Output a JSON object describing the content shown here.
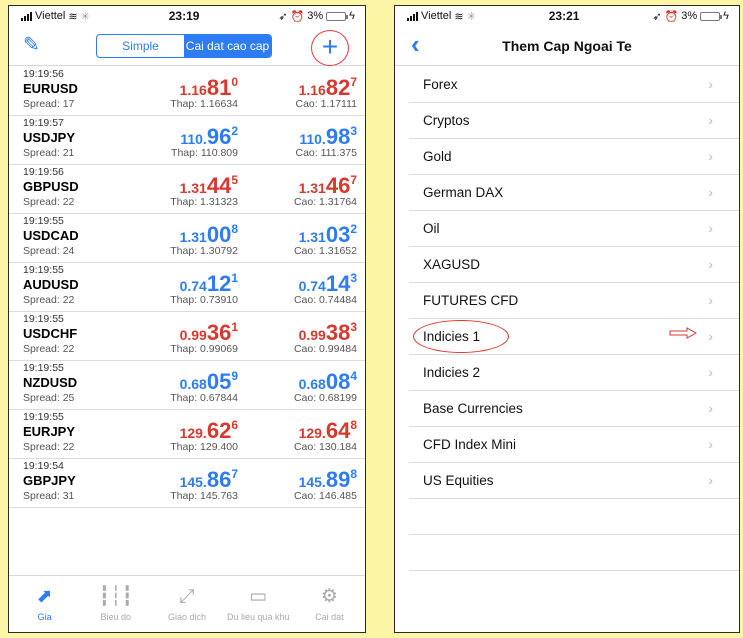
{
  "left": {
    "status": {
      "carrier": "Viettel",
      "time": "23:19",
      "battery": "3%"
    },
    "segments": [
      "Simple",
      "Cai dat cao cap"
    ],
    "add_label": "+",
    "quotes": [
      {
        "time": "19:19:56",
        "symbol": "EURUSD",
        "spread": "Spread: 17",
        "bid_small": "1.16",
        "bid_big": "81",
        "bid_sup": "0",
        "ask_small": "1.16",
        "ask_big": "82",
        "ask_sup": "7",
        "low": "Thap: 1.16634",
        "high": "Cao: 1.17111",
        "bid_color": "red",
        "ask_color": "red"
      },
      {
        "time": "19:19:57",
        "symbol": "USDJPY",
        "spread": "Spread: 21",
        "bid_small": "110.",
        "bid_big": "96",
        "bid_sup": "2",
        "ask_small": "110.",
        "ask_big": "98",
        "ask_sup": "3",
        "low": "Thap: 110.809",
        "high": "Cao: 111.375",
        "bid_color": "blue",
        "ask_color": "blue"
      },
      {
        "time": "19:19:56",
        "symbol": "GBPUSD",
        "spread": "Spread: 22",
        "bid_small": "1.31",
        "bid_big": "44",
        "bid_sup": "5",
        "ask_small": "1.31",
        "ask_big": "46",
        "ask_sup": "7",
        "low": "Thap: 1.31323",
        "high": "Cao: 1.31764",
        "bid_color": "red",
        "ask_color": "red"
      },
      {
        "time": "19:19:55",
        "symbol": "USDCAD",
        "spread": "Spread: 24",
        "bid_small": "1.31",
        "bid_big": "00",
        "bid_sup": "8",
        "ask_small": "1.31",
        "ask_big": "03",
        "ask_sup": "2",
        "low": "Thap: 1.30792",
        "high": "Cao: 1.31652",
        "bid_color": "blue",
        "ask_color": "blue"
      },
      {
        "time": "19:19:55",
        "symbol": "AUDUSD",
        "spread": "Spread: 22",
        "bid_small": "0.74",
        "bid_big": "12",
        "bid_sup": "1",
        "ask_small": "0.74",
        "ask_big": "14",
        "ask_sup": "3",
        "low": "Thap: 0.73910",
        "high": "Cao: 0.74484",
        "bid_color": "blue",
        "ask_color": "blue"
      },
      {
        "time": "19:19:55",
        "symbol": "USDCHF",
        "spread": "Spread: 22",
        "bid_small": "0.99",
        "bid_big": "36",
        "bid_sup": "1",
        "ask_small": "0.99",
        "ask_big": "38",
        "ask_sup": "3",
        "low": "Thap: 0.99069",
        "high": "Cao: 0.99484",
        "bid_color": "red",
        "ask_color": "red"
      },
      {
        "time": "19:19:55",
        "symbol": "NZDUSD",
        "spread": "Spread: 25",
        "bid_small": "0.68",
        "bid_big": "05",
        "bid_sup": "9",
        "ask_small": "0.68",
        "ask_big": "08",
        "ask_sup": "4",
        "low": "Thap: 0.67844",
        "high": "Cao: 0.68199",
        "bid_color": "blue",
        "ask_color": "blue"
      },
      {
        "time": "19:19:55",
        "symbol": "EURJPY",
        "spread": "Spread: 22",
        "bid_small": "129.",
        "bid_big": "62",
        "bid_sup": "6",
        "ask_small": "129.",
        "ask_big": "64",
        "ask_sup": "8",
        "low": "Thap: 129.400",
        "high": "Cao: 130.184",
        "bid_color": "red",
        "ask_color": "red"
      },
      {
        "time": "19:19:54",
        "symbol": "GBPJPY",
        "spread": "Spread: 31",
        "bid_small": "145.",
        "bid_big": "86",
        "bid_sup": "7",
        "ask_small": "145.",
        "ask_big": "89",
        "ask_sup": "8",
        "low": "Thap: 145.763",
        "high": "Cao: 146.485",
        "bid_color": "blue",
        "ask_color": "blue"
      }
    ],
    "tabs": [
      {
        "label": "Gia",
        "icon": "chart-arrow-icon"
      },
      {
        "label": "Bieu do",
        "icon": "candlestick-icon"
      },
      {
        "label": "Giao dich",
        "icon": "trade-icon"
      },
      {
        "label": "Du lieu qua khu",
        "icon": "inbox-icon"
      },
      {
        "label": "Cai dat",
        "icon": "gear-icon"
      }
    ]
  },
  "right": {
    "status": {
      "carrier": "Viettel",
      "time": "23:21",
      "battery": "3%"
    },
    "title": "Them Cap Ngoai Te",
    "items": [
      "Forex",
      "Cryptos",
      "Gold",
      "German DAX",
      "Oil",
      "XAGUSD",
      "FUTURES CFD",
      "Indicies 1",
      "Indicies 2",
      "Base Currencies",
      "CFD Index Mini",
      "US Equities"
    ]
  },
  "colors": {
    "accent": "#2d7cf6",
    "down": "#d8392e",
    "background": "#fdf5a6"
  }
}
